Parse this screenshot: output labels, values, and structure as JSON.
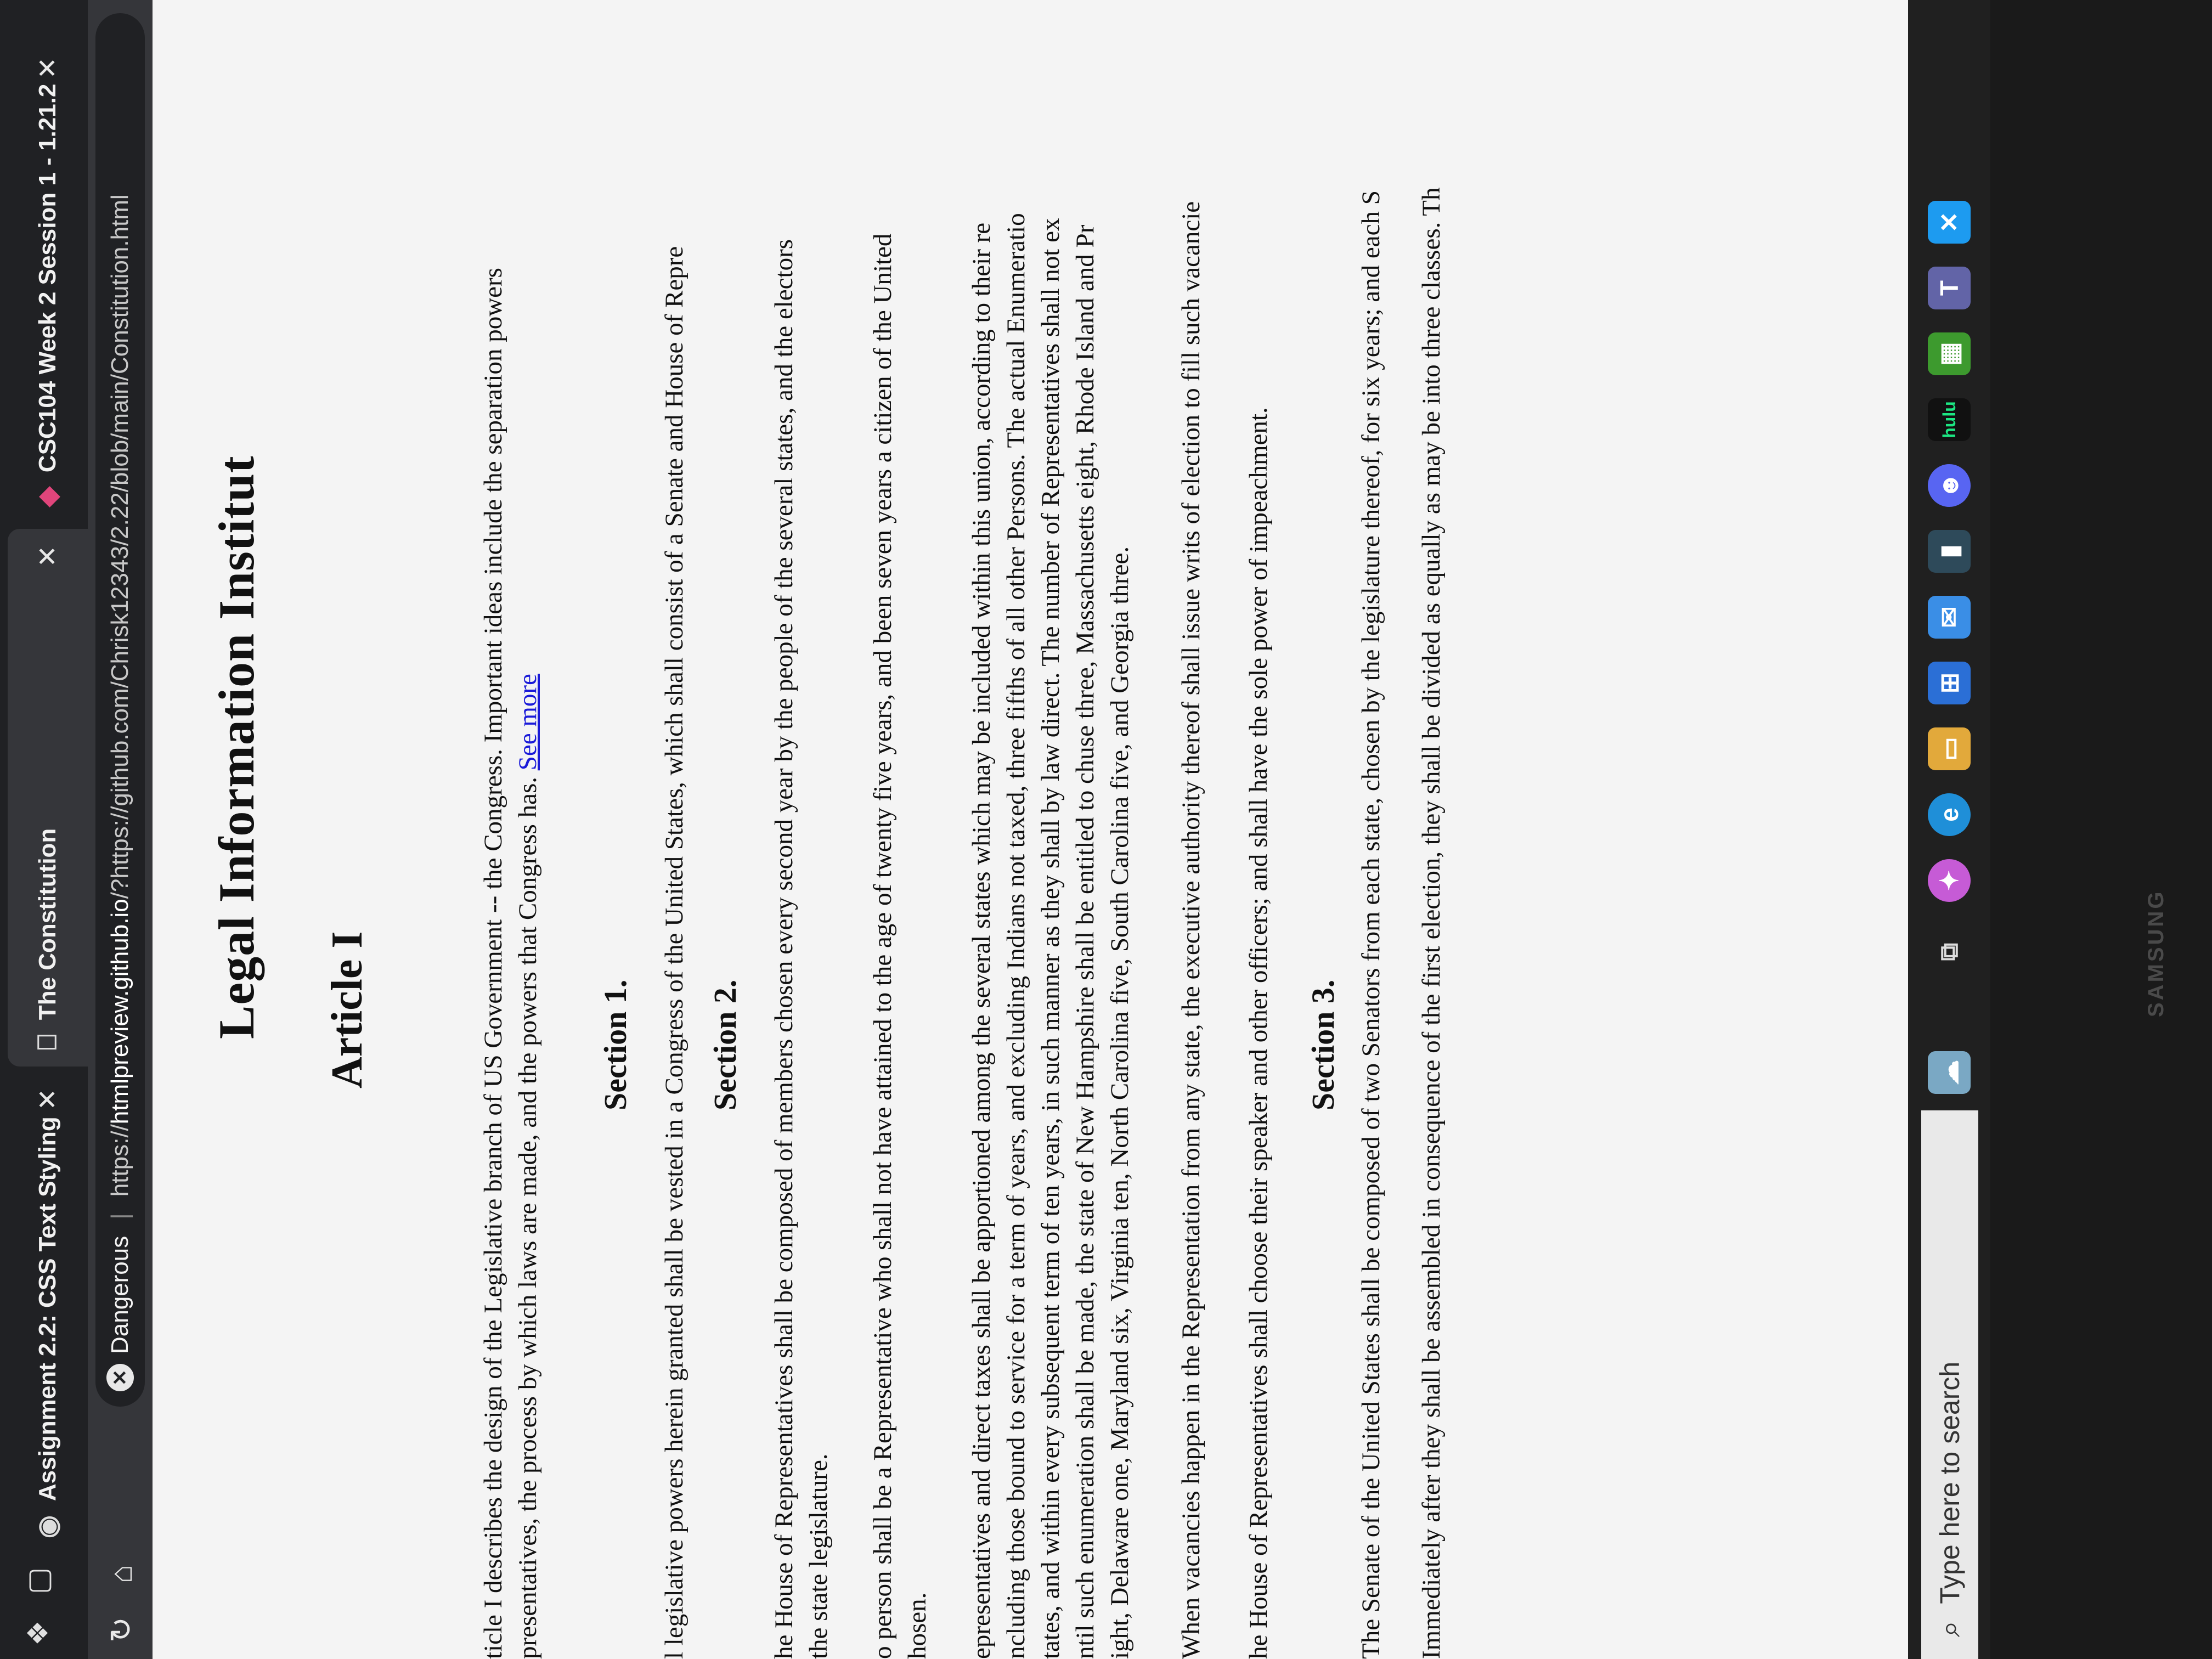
{
  "browser": {
    "tabs": [
      {
        "label": "Assignment 2.2: CSS Text Styling",
        "icon": "site-icon",
        "active": false
      },
      {
        "label": "The Constitution",
        "icon": "page-icon",
        "active": true
      },
      {
        "label": "CSC104 Week 2 Session 1 - 1.21.2",
        "icon": "brand-icon",
        "active": false
      }
    ],
    "security_label": "Dangerous",
    "url_host": "htmlpreview.github.io",
    "url_prefix": "https://",
    "url_rest": "/?https://github.com/Chrisk12343/2.22/blob/main/Constitution.html"
  },
  "page": {
    "site_title": "Legal Information Institut",
    "article_title": "Article I",
    "intro_line1": "ticle I describes the design of the Legislative branch of US Government -- the Congress. Important ideas include the separation powers",
    "intro_line2": "presentatives, the process by which laws are made, and the powers that Congress has.",
    "see_more": "See more",
    "section1_heading": "Section 1.",
    "section1_text": "l legislative powers herein granted shall be vested in a Congress of the United States, which shall consist of a Senate and House of Repre",
    "section2_heading": "Section 2.",
    "s2_p1_line1": "he House of Representatives shall be composed of members chosen every second year by the people of the several states, and the electors",
    "s2_p1_line2": "the state legislature.",
    "s2_p2_line1": "o person shall be a Representative who shall not have attained to the age of twenty five years, and been seven years a citizen of the United",
    "s2_p2_line2": "hosen.",
    "s2_p3_line1": "epresentatives and direct taxes shall be apportioned among the several states which may be included within this union, according to their re",
    "s2_p3_line2": "ncluding those bound to service for a term of years, and excluding Indians not taxed, three fifths of all other Persons. The actual Enumeratio",
    "s2_p3_line3": "tates, and within every subsequent term of ten years, in such manner as they shall by law direct. The number of Representatives shall not ex",
    "s2_p3_line4": "ntil such enumeration shall be made, the state of New Hampshire shall be entitled to chuse three, Massachusetts eight, Rhode Island and Pr",
    "s2_p3_line5": "ight, Delaware one, Maryland six, Virginia ten, North Carolina five, South Carolina five, and Georgia three.",
    "s2_p4_line1": "When vacancies happen in the Representation from any state, the executive authority thereof shall issue writs of election to fill such vacancie",
    "s2_p5_line1": "he House of Representatives shall choose their speaker and other officers; and shall have the sole power of impeachment.",
    "section3_heading": "Section 3.",
    "s3_p1_line1": "The Senate of the United States shall be composed of two Senators from each state, chosen by the legislature thereof, for six years; and each S",
    "s3_p2_line1": "Immediately after they shall be assembled in consequence of the first election, they shall be divided as equally as may be into three classes. Th"
  },
  "taskbar": {
    "search_placeholder": "Type here to search",
    "hulu_label": "hulu",
    "brand": "SAMSUNG",
    "colors": {
      "edge": "#1f8fd8",
      "copilot": "#c65bd6",
      "store": "#2b6fd6",
      "mail": "#3a8ee6",
      "discord": "#5865f2",
      "hulu": "#1ce783",
      "minecraft": "#3d9a2e",
      "teams": "#6264a7",
      "x": "#1d9bf0"
    }
  }
}
